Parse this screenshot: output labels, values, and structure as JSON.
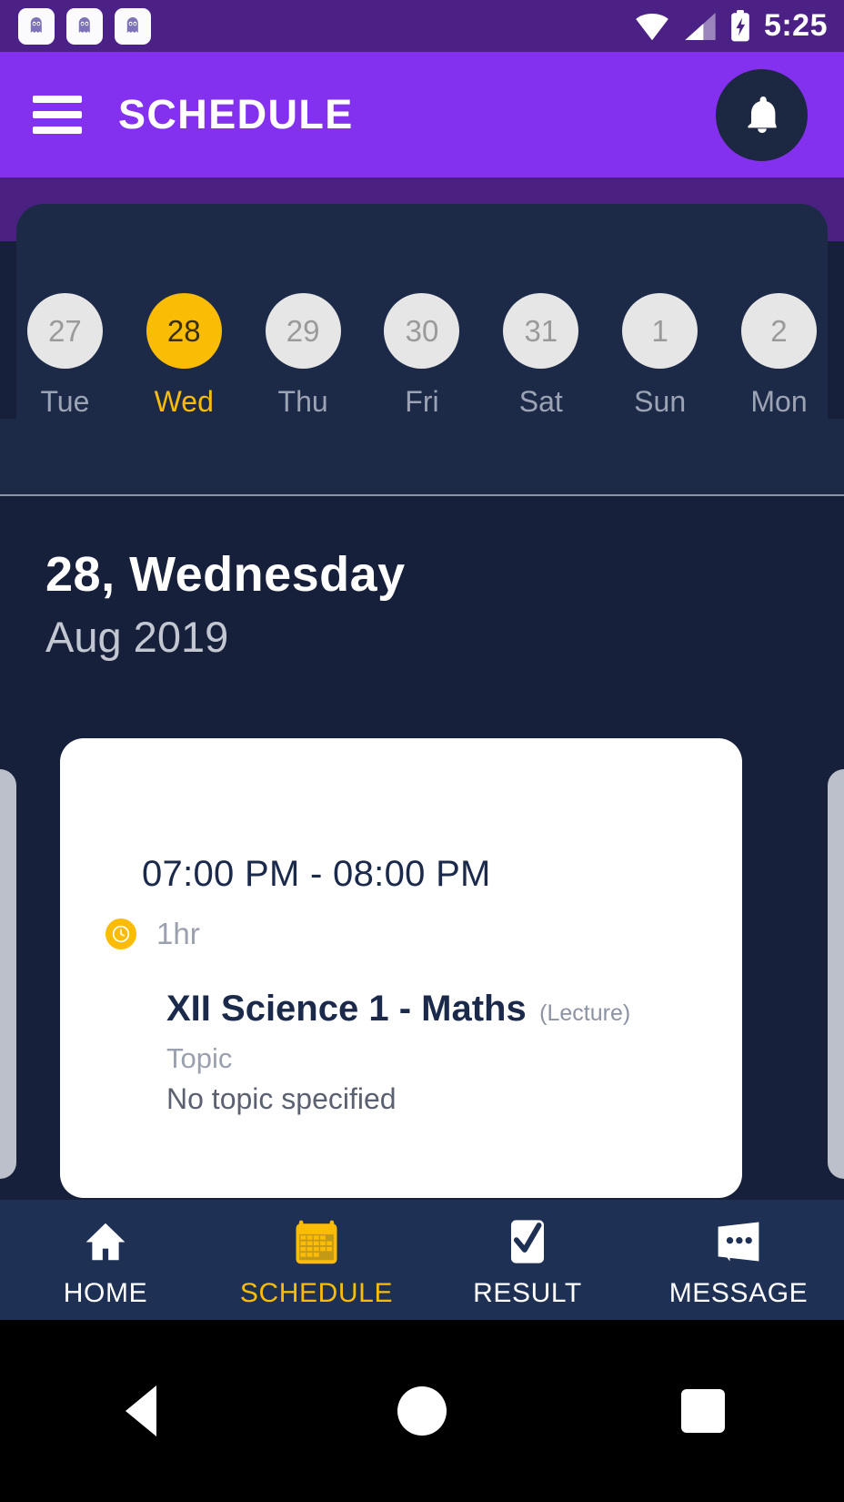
{
  "statusbar": {
    "notification_icons": [
      "app-ghost-icon",
      "app-ghost-icon",
      "app-ghost-icon"
    ],
    "wifi_icon": "wifi-icon",
    "signal_icon": "cellular-signal-icon",
    "battery_icon": "battery-charging-icon",
    "time": "5:25"
  },
  "appbar": {
    "menu_icon": "hamburger-menu-icon",
    "title": "SCHEDULE",
    "notification_icon": "bell-icon"
  },
  "calendar_strip": {
    "days": [
      {
        "date": "27",
        "weekday": "Tue",
        "selected": false
      },
      {
        "date": "28",
        "weekday": "Wed",
        "selected": true
      },
      {
        "date": "29",
        "weekday": "Thu",
        "selected": false
      },
      {
        "date": "30",
        "weekday": "Fri",
        "selected": false
      },
      {
        "date": "31",
        "weekday": "Sat",
        "selected": false
      },
      {
        "date": "1",
        "weekday": "Sun",
        "selected": false
      },
      {
        "date": "2",
        "weekday": "Mon",
        "selected": false
      }
    ]
  },
  "date_header": {
    "primary": "28, Wednesday",
    "secondary": "Aug 2019"
  },
  "event": {
    "time_range": "07:00 PM - 08:00 PM",
    "duration_icon": "clock-icon",
    "duration": "1hr",
    "title": "XII Science 1 - Maths",
    "kind": "(Lecture)",
    "topic_label": "Topic",
    "topic_value": "No topic specified"
  },
  "bottom_nav": {
    "items": [
      {
        "label": "HOME",
        "icon": "home-icon",
        "active": false
      },
      {
        "label": "SCHEDULE",
        "icon": "calendar-icon",
        "active": true
      },
      {
        "label": "RESULT",
        "icon": "result-icon",
        "active": false
      },
      {
        "label": "MESSAGE",
        "icon": "message-icon",
        "active": false
      }
    ]
  },
  "android_nav": {
    "back": "back-triangle-icon",
    "home": "home-circle-icon",
    "recents": "recents-square-icon"
  },
  "colors": {
    "status_bar": "#4b2185",
    "app_bar": "#8430ef",
    "panel": "#1c2a48",
    "page_bg": "#17203a",
    "accent": "#fbbc05",
    "bottom_nav": "#1e3054",
    "card": "#ffffff"
  }
}
